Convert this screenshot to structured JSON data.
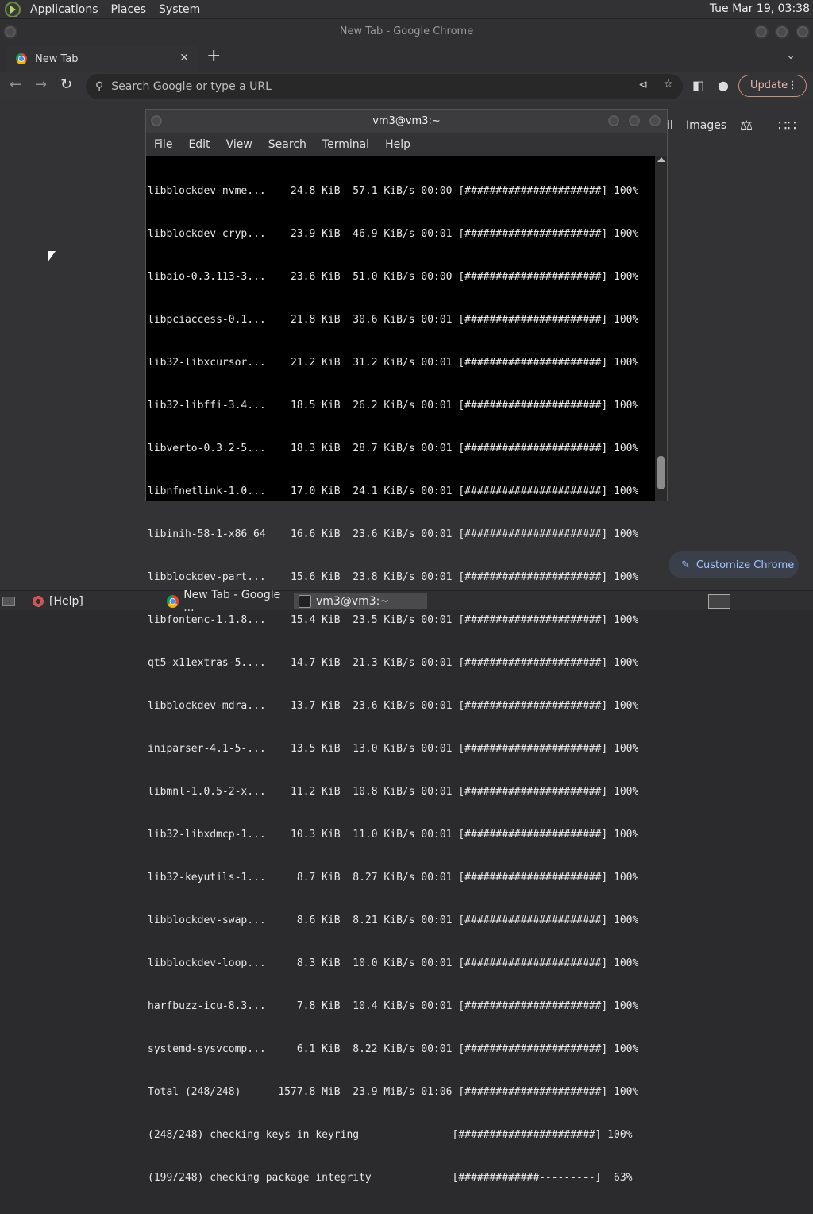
{
  "system": {
    "menus": [
      "Applications",
      "Places",
      "System"
    ],
    "clock": "Tue Mar 19, 03:38"
  },
  "chrome": {
    "window_title": "New Tab - Google Chrome",
    "tab_label": "New Tab",
    "tab_close": "✕",
    "new_tab": "+",
    "omnibox_placeholder": "Search Google or type a URL",
    "update_label": "Update",
    "gbar": {
      "mail_partial": "il",
      "images": "Images"
    },
    "customize_label": "Customize Chrome"
  },
  "terminal": {
    "title": "vm3@vm3:~",
    "menu": [
      "File",
      "Edit",
      "View",
      "Search",
      "Terminal",
      "Help"
    ],
    "lines": [
      "libblockdev-nvme...    24.8 KiB  57.1 KiB/s 00:00 [######################] 100%",
      "libblockdev-cryp...    23.9 KiB  46.9 KiB/s 00:01 [######################] 100%",
      "libaio-0.3.113-3...    23.6 KiB  51.0 KiB/s 00:00 [######################] 100%",
      "libpciaccess-0.1...    21.8 KiB  30.6 KiB/s 00:01 [######################] 100%",
      "lib32-libxcursor...    21.2 KiB  31.2 KiB/s 00:01 [######################] 100%",
      "lib32-libffi-3.4...    18.5 KiB  26.2 KiB/s 00:01 [######################] 100%",
      "libverto-0.3.2-5...    18.3 KiB  28.7 KiB/s 00:01 [######################] 100%",
      "libnfnetlink-1.0...    17.0 KiB  24.1 KiB/s 00:01 [######################] 100%",
      "libinih-58-1-x86_64    16.6 KiB  23.6 KiB/s 00:01 [######################] 100%",
      "libblockdev-part...    15.6 KiB  23.8 KiB/s 00:01 [######################] 100%",
      "libfontenc-1.1.8...    15.4 KiB  23.5 KiB/s 00:01 [######################] 100%",
      "qt5-x11extras-5....    14.7 KiB  21.3 KiB/s 00:01 [######################] 100%",
      "libblockdev-mdra...    13.7 KiB  23.6 KiB/s 00:01 [######################] 100%",
      "iniparser-4.1-5-...    13.5 KiB  13.0 KiB/s 00:01 [######################] 100%",
      "libmnl-1.0.5-2-x...    11.2 KiB  10.8 KiB/s 00:01 [######################] 100%",
      "lib32-libxdmcp-1...    10.3 KiB  11.0 KiB/s 00:01 [######################] 100%",
      "lib32-keyutils-1...     8.7 KiB  8.27 KiB/s 00:01 [######################] 100%",
      "libblockdev-swap...     8.6 KiB  8.21 KiB/s 00:01 [######################] 100%",
      "libblockdev-loop...     8.3 KiB  10.0 KiB/s 00:01 [######################] 100%",
      "harfbuzz-icu-8.3...     7.8 KiB  10.4 KiB/s 00:01 [######################] 100%",
      "systemd-sysvcomp...     6.1 KiB  8.22 KiB/s 00:01 [######################] 100%",
      "Total (248/248)      1577.8 MiB  23.9 MiB/s 01:06 [######################] 100%",
      "(248/248) checking keys in keyring               [######################] 100%",
      "(199/248) checking package integrity             [#############---------]  63%"
    ]
  },
  "taskbar": {
    "items": [
      "[Help]",
      "New Tab - Google ...",
      "vm3@vm3:~"
    ]
  }
}
